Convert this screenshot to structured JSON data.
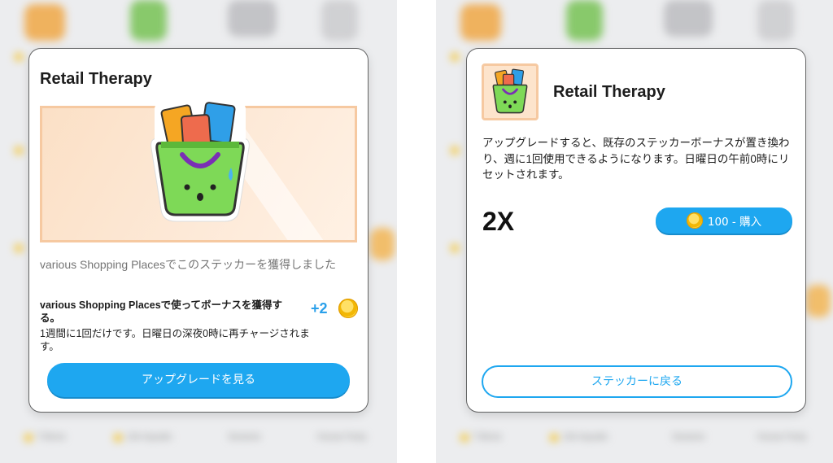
{
  "left_screen": {
    "backdrop_labels": [
      "T-Bone",
      "Life Aquatic",
      "Sesame",
      "House Party"
    ],
    "card": {
      "title": "Retail Therapy",
      "earned_text": "various Shopping Placesでこのステッカーを獲得しました",
      "bonus_title": "various Shopping Placesで使ってボーナスを獲得する。",
      "bonus_desc": "1週間に1回だけです。日曜日の深夜0時に再チャージされます。",
      "bonus_amount": "+2",
      "bonus_icon": "coin-icon",
      "button_label": "アップグレードを見る"
    }
  },
  "right_screen": {
    "backdrop_labels": [
      "T-Bone",
      "Life Aquatic",
      "Sesame",
      "House Party"
    ],
    "card": {
      "title": "Retail Therapy",
      "upgrade_desc": "アップグレードすると、既存のステッカーボーナスが置き換わり、週に1回使用できるようになります。日曜日の午前0時にリセットされます。",
      "multiplier": "2X",
      "buy_label": "100 - 購入",
      "buy_icon": "coin-icon",
      "back_label": "ステッカーに戻る"
    }
  },
  "colors": {
    "accent": "#1ea7f0",
    "bag_green": "#7ed957",
    "coin_gold": "#f2b705",
    "banner_bg": "#fde4cc"
  }
}
